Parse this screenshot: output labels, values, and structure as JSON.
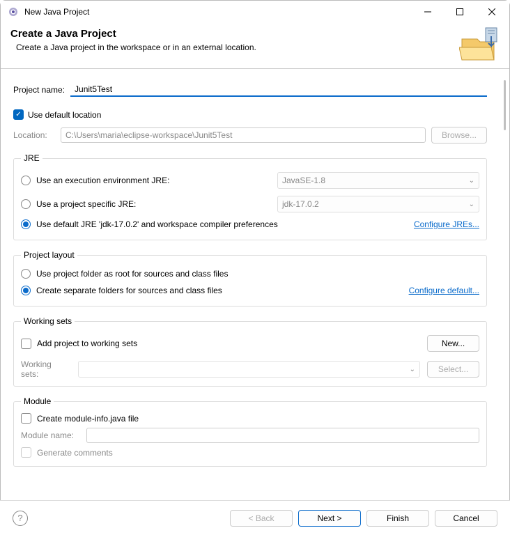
{
  "titlebar": {
    "title": "New Java Project"
  },
  "header": {
    "title": "Create a Java Project",
    "description": "Create a Java project in the workspace or in an external location."
  },
  "projectName": {
    "label": "Project name:",
    "value": "Junit5Test"
  },
  "defaultLocation": {
    "checkboxLabel": "Use default location",
    "locationLabel": "Location:",
    "locationValue": "C:\\Users\\maria\\eclipse-workspace\\Junit5Test",
    "browseLabel": "Browse..."
  },
  "jre": {
    "legend": "JRE",
    "option1": "Use an execution environment JRE:",
    "option1Value": "JavaSE-1.8",
    "option2": "Use a project specific JRE:",
    "option2Value": "jdk-17.0.2",
    "option3": "Use default JRE 'jdk-17.0.2' and workspace compiler preferences",
    "configureLink": "Configure JREs..."
  },
  "layout": {
    "legend": "Project layout",
    "option1": "Use project folder as root for sources and class files",
    "option2": "Create separate folders for sources and class files",
    "configureLink": "Configure default..."
  },
  "workingSets": {
    "legend": "Working sets",
    "checkboxLabel": "Add project to working sets",
    "newLabel": "New...",
    "selectLabel": "Working sets:",
    "selectButtonLabel": "Select..."
  },
  "module": {
    "legend": "Module",
    "checkboxLabel": "Create module-info.java file",
    "moduleNameLabel": "Module name:",
    "generateCommentsLabel": "Generate comments"
  },
  "footer": {
    "back": "< Back",
    "next": "Next >",
    "finish": "Finish",
    "cancel": "Cancel"
  }
}
